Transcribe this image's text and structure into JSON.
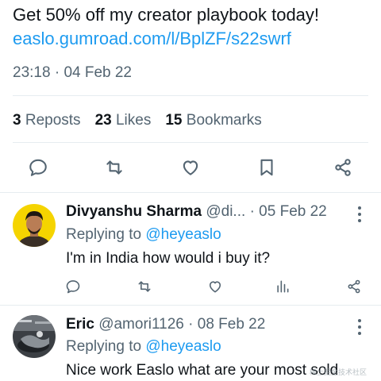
{
  "tweet": {
    "text": "Get 50% off my creator playbook today!",
    "link": "easlo.gumroad.com/l/BplZF/s22swrf",
    "time": "23:18",
    "separator": "·",
    "date": "04 Feb 22"
  },
  "stats": {
    "reposts_count": "3",
    "reposts_label": "Reposts",
    "likes_count": "23",
    "likes_label": "Likes",
    "bookmarks_count": "15",
    "bookmarks_label": "Bookmarks"
  },
  "actions": [
    "reply-icon",
    "repost-icon",
    "like-icon",
    "bookmark-icon",
    "share-icon"
  ],
  "replies": [
    {
      "name": "Divyanshu Sharma",
      "handle": "@di...",
      "separator": "·",
      "date": "05 Feb 22",
      "replying_prefix": "Replying to",
      "replying_handle": "@heyeaslo",
      "text": "I'm in India how would i buy it?",
      "actions": [
        "reply-icon",
        "repost-icon",
        "like-icon",
        "views-icon",
        "share-icon"
      ]
    },
    {
      "name": "Eric",
      "handle": "@amori1126",
      "separator": "·",
      "date": "08 Feb 22",
      "replying_prefix": "Replying to",
      "replying_handle": "@heyeaslo",
      "text": "Nice work Easlo what are your most sold"
    }
  ],
  "watermark": "稀土掘金技术社区",
  "colors": {
    "link": "#1d9bf0",
    "secondary_text": "#536471",
    "primary_text": "#0f1419",
    "divider": "#e6ecf0"
  }
}
